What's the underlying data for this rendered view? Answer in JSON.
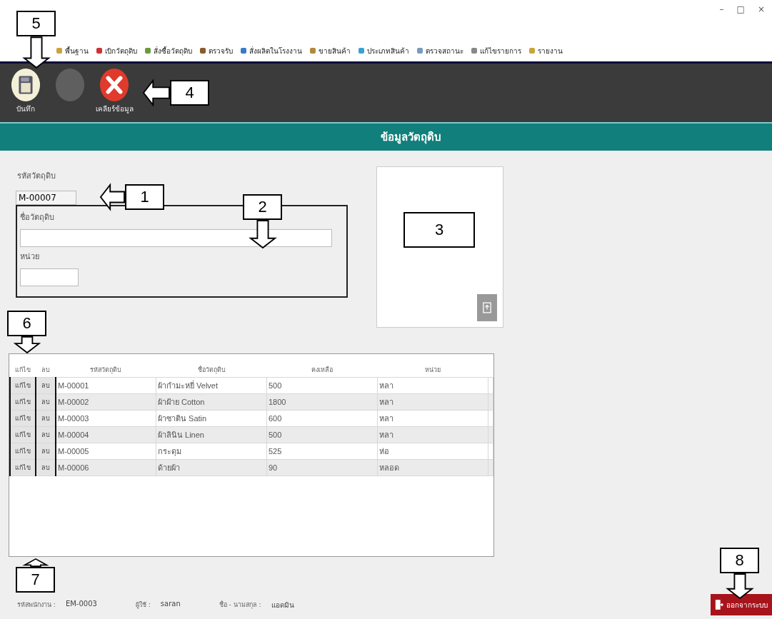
{
  "window": {
    "controls": [
      "–",
      "□",
      "×"
    ]
  },
  "menu": [
    {
      "label": "พื้นฐาน"
    },
    {
      "label": "เบิกวัตถุดิบ"
    },
    {
      "label": "สั่งซื้อวัตถุดิบ"
    },
    {
      "label": "ตรวจรับ"
    },
    {
      "label": "สั่งผลิตในโรงงาน"
    },
    {
      "label": "ขายสินค้า"
    },
    {
      "label": "ประเภทสินค้า"
    },
    {
      "label": "ตรวจสถานะ"
    },
    {
      "label": "แก้ไขรายการ"
    },
    {
      "label": "รายงาน"
    }
  ],
  "toolbar": [
    {
      "kind": "save",
      "label": "บันทึก",
      "disabled": false
    },
    {
      "kind": "blank",
      "disabled": true
    },
    {
      "kind": "clear",
      "label": "เคลียร์ข้อมูล",
      "disabled": false
    }
  ],
  "header": "ข้อมูลวัตถุดิบ",
  "form": {
    "code_label": "รหัสวัตถุดิบ",
    "code_value": "M-00007",
    "name_label": "ชื่อวัตถุดิบ",
    "unit_label": "หน่วย"
  },
  "table": {
    "columns": [
      "แก้ไข",
      "ลบ",
      "รหัสวัตถุดิบ",
      "ชื่อวัตถุดิบ",
      "คงเหลือ",
      "หน่วย"
    ],
    "rows": [
      {
        "edit": "แก้ไข",
        "delete": "ลบ",
        "code": "M-00001",
        "name": "ผ้ากำมะหยี่ Velvet",
        "stock": "500",
        "unit": "หลา"
      },
      {
        "edit": "แก้ไข",
        "delete": "ลบ",
        "code": "M-00002",
        "name": "ผ้าฝ้าย Cotton",
        "stock": "1800",
        "unit": "หลา"
      },
      {
        "edit": "แก้ไข",
        "delete": "ลบ",
        "code": "M-00003",
        "name": "ผ้าซาติน Satin",
        "stock": "600",
        "unit": "หลา"
      },
      {
        "edit": "แก้ไข",
        "delete": "ลบ",
        "code": "M-00004",
        "name": "ผ้าลินิน Linen",
        "stock": "500",
        "unit": "หลา"
      },
      {
        "edit": "แก้ไข",
        "delete": "ลบ",
        "code": "M-00005",
        "name": "กระดุม",
        "stock": "525",
        "unit": "ห่อ"
      },
      {
        "edit": "แก้ไข",
        "delete": "ลบ",
        "code": "M-00006",
        "name": "ด้ายผ้า",
        "stock": "90",
        "unit": "หลอด"
      }
    ]
  },
  "footer": [
    {
      "label": "รหัสพนักงาน :",
      "value": "EM-0003"
    },
    {
      "label": "ผู้ใช้ :",
      "value": "saran"
    },
    {
      "label": "ชื่อ - นามสกุล :",
      "value": "แอดมิน"
    }
  ],
  "logout": "ออกจากระบบ",
  "callouts": [
    {
      "number": "1",
      "kind": "left"
    },
    {
      "number": "2",
      "kind": "down"
    },
    {
      "number": "3",
      "kind": "plain"
    },
    {
      "number": "4",
      "kind": "left"
    },
    {
      "number": "5",
      "kind": "down"
    },
    {
      "number": "6",
      "kind": "down"
    },
    {
      "number": "7",
      "kind": "up"
    },
    {
      "number": "8",
      "kind": "down"
    }
  ]
}
